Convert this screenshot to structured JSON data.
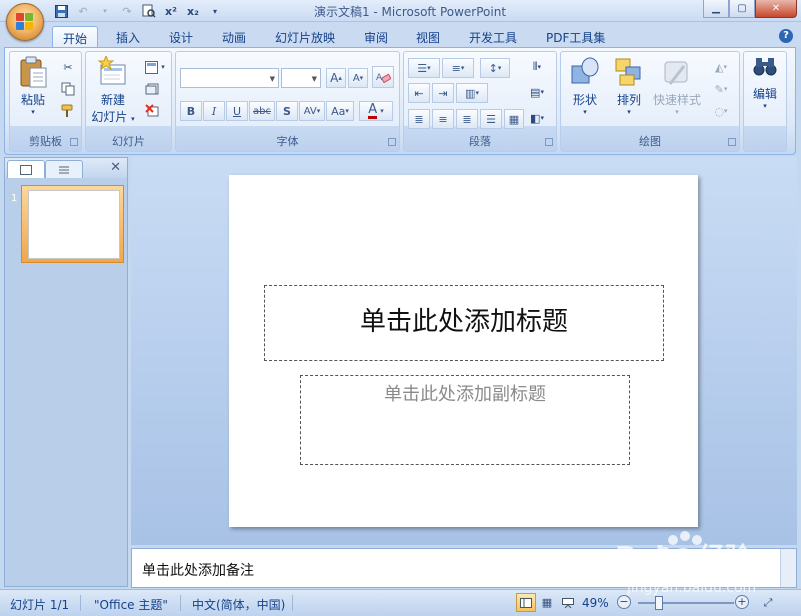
{
  "window": {
    "title": "演示文稿1 - Microsoft PowerPoint",
    "controls": [
      "minimize",
      "maximize",
      "close"
    ]
  },
  "quick_access": {
    "items": [
      "save-icon",
      "undo-icon",
      "redo-icon",
      "print-preview-icon",
      "superscript-icon",
      "subscript-icon",
      "customize-icon"
    ],
    "superscript_label": "x²",
    "subscript_label": "x₂"
  },
  "tabs": {
    "items": [
      {
        "label": "开始",
        "active": true
      },
      {
        "label": "插入",
        "active": false
      },
      {
        "label": "设计",
        "active": false
      },
      {
        "label": "动画",
        "active": false
      },
      {
        "label": "幻灯片放映",
        "active": false
      },
      {
        "label": "审阅",
        "active": false
      },
      {
        "label": "视图",
        "active": false
      },
      {
        "label": "开发工具",
        "active": false
      },
      {
        "label": "PDF工具集",
        "active": false
      }
    ]
  },
  "ribbon": {
    "clipboard": {
      "group_label": "剪贴板",
      "paste_label": "粘贴"
    },
    "slides": {
      "group_label": "幻灯片",
      "new_slide_line1": "新建",
      "new_slide_line2": "幻灯片"
    },
    "font": {
      "group_label": "字体",
      "font_name_value": "",
      "font_size_value": "",
      "grow_label": "A",
      "shrink_label": "A",
      "bold_label": "B",
      "italic_label": "I",
      "underline_label": "U",
      "strike_label": "abc",
      "shadow_label": "S",
      "spacing_label": "AV",
      "case_label": "Aa",
      "color_label": "A"
    },
    "paragraph": {
      "group_label": "段落"
    },
    "drawing": {
      "group_label": "绘图",
      "shapes_label": "形状",
      "arrange_label": "排列",
      "quick_styles_label": "快速样式"
    },
    "editing": {
      "edit_label": "编辑"
    }
  },
  "slide_panel": {
    "slide_number": "1"
  },
  "slide": {
    "title_placeholder": "单击此处添加标题",
    "subtitle_placeholder": "单击此处添加副标题"
  },
  "notes": {
    "placeholder": "单击此处添加备注"
  },
  "status": {
    "slide_info": "幻灯片 1/1",
    "theme": "\"Office 主题\"",
    "language": "中文(简体，中国)",
    "zoom": "49%",
    "zoom_fraction": 0.49
  },
  "colors": {
    "accent": "#15428b",
    "ribbon_bg": "#dde9f8",
    "active_view": "#f6c35c"
  }
}
